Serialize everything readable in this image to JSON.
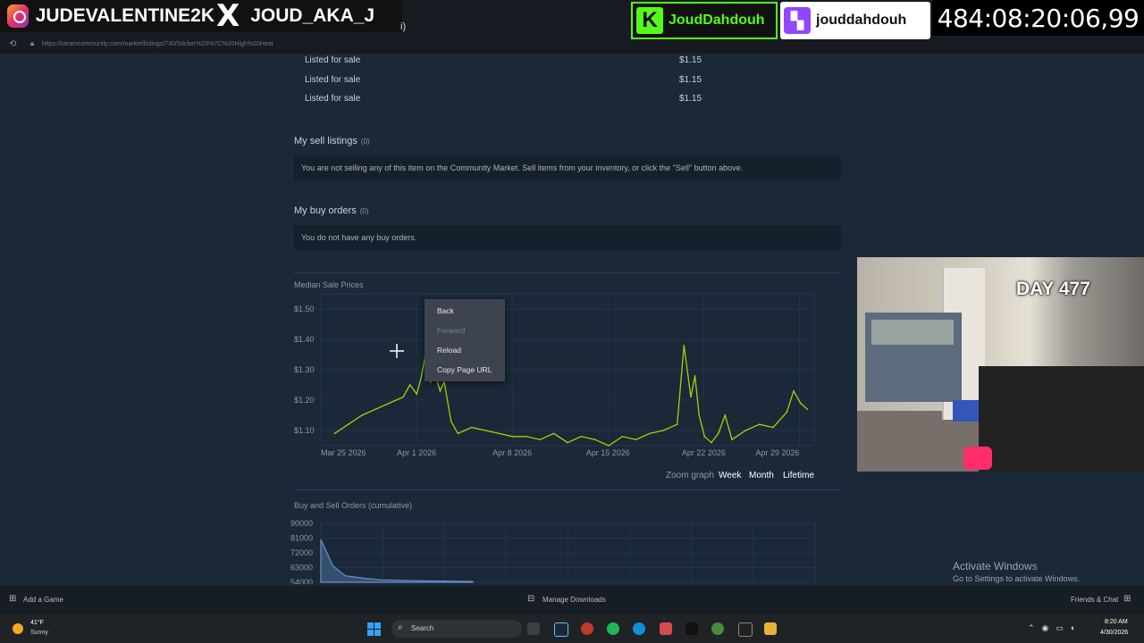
{
  "browser": {
    "url": "https://steamcommunity.com/market/listings/730/Sticker%20%7C%20High%20Heat",
    "nav_icon": "refresh-icon",
    "lock_icon": "lock-icon"
  },
  "overlays": {
    "instagram": "JUDEVALENTINE2K",
    "x_handle": "JOUD_AKA_J",
    "x_tail": "i)",
    "kick": "JoudDahdouh",
    "twitch": "jouddahdouh",
    "timer": "484:08:20:06,99",
    "day": "DAY 477"
  },
  "listings": [
    {
      "status": "Listed for sale",
      "price": "$1.15"
    },
    {
      "status": "Listed for sale",
      "price": "$1.15"
    },
    {
      "status": "Listed for sale",
      "price": "$1.15"
    }
  ],
  "sell_listings": {
    "title": "My sell listings",
    "count": "(0)",
    "message": "You are not selling any of this item on the Community Market. Sell items from your inventory, or click the \"Sell\" button above."
  },
  "buy_orders": {
    "title": "My buy orders",
    "count": "(0)",
    "message": "You do not have any buy orders."
  },
  "context_menu": {
    "items": [
      {
        "label": "Back",
        "enabled": true
      },
      {
        "label": "Forward",
        "enabled": false
      },
      {
        "label": "Reload",
        "enabled": true
      },
      {
        "label": "Copy Page URL",
        "enabled": true
      }
    ]
  },
  "zoom": {
    "label": "Zoom graph",
    "options": [
      "Week",
      "Month",
      "Lifetime"
    ]
  },
  "chart_data": [
    {
      "type": "line",
      "title": "Median Sale Prices",
      "y_ticks": [
        "$1.50",
        "$1.40",
        "$1.30",
        "$1.20",
        "$1.10"
      ],
      "x_ticks": [
        "Mar 25 2026",
        "Apr 1 2026",
        "Apr 8 2026",
        "Apr 15 2026",
        "Apr 22 2026",
        "Apr 29 2026"
      ],
      "ylim": [
        1.05,
        1.55
      ],
      "xlim": [
        0,
        36
      ],
      "series_color": "#a4d007",
      "x": [
        1,
        2,
        3,
        4,
        5,
        6,
        6.5,
        7,
        7.3,
        7.6,
        8,
        8.3,
        8.7,
        9,
        9.5,
        10,
        11,
        12,
        13,
        14,
        15,
        16,
        17,
        18,
        19,
        20,
        21,
        22,
        23,
        24,
        25,
        26,
        26.5,
        27,
        27.3,
        27.6,
        28,
        28.5,
        29,
        29.5,
        30,
        31,
        32,
        33,
        34,
        34.5,
        35,
        35.5
      ],
      "y": [
        1.09,
        1.12,
        1.15,
        1.17,
        1.19,
        1.21,
        1.25,
        1.22,
        1.27,
        1.34,
        1.26,
        1.29,
        1.23,
        1.26,
        1.13,
        1.09,
        1.11,
        1.1,
        1.09,
        1.08,
        1.08,
        1.07,
        1.09,
        1.06,
        1.08,
        1.07,
        1.05,
        1.08,
        1.07,
        1.09,
        1.1,
        1.12,
        1.38,
        1.21,
        1.28,
        1.15,
        1.08,
        1.06,
        1.09,
        1.15,
        1.07,
        1.1,
        1.12,
        1.11,
        1.16,
        1.23,
        1.19,
        1.17
      ]
    },
    {
      "type": "area",
      "title": "Buy and Sell Orders (cumulative)",
      "y_ticks": [
        "90000",
        "81000",
        "72000",
        "63000",
        "54000"
      ],
      "ylim": [
        54000,
        90000
      ],
      "series_color": "#6b8fc2",
      "x": [
        1.05,
        1.07,
        1.09,
        1.12,
        1.15,
        1.2,
        1.3
      ],
      "y": [
        80000,
        64000,
        58000,
        56500,
        55500,
        55000,
        54500
      ]
    }
  ],
  "steam_bar": {
    "add_game": "Add a Game",
    "manage_downloads": "Manage Downloads",
    "friends_chat": "Friends & Chat"
  },
  "activate_windows": {
    "title": "Activate Windows",
    "subtitle": "Go to Settings to activate Windows."
  },
  "taskbar": {
    "weather_temp": "41°F",
    "weather_desc": "Sunny",
    "search_label": "Search",
    "time": "8:20 AM",
    "date": "4/30/2026"
  }
}
